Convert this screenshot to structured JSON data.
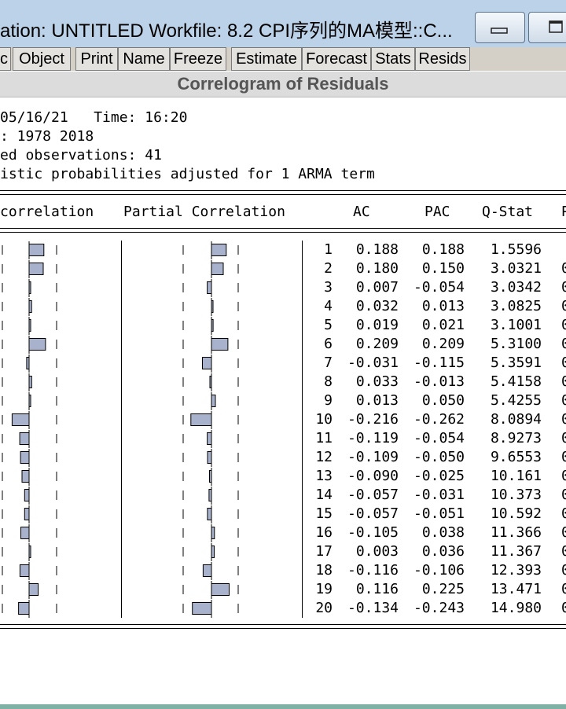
{
  "window": {
    "title": "ation: UNTITLED   Workfile: 8.2 CPI序列的MA模型::C..."
  },
  "toolbar": {
    "buttons": [
      "c",
      "Object",
      "Print",
      "Name",
      "Freeze",
      "Estimate",
      "Forecast",
      "Stats",
      "Resids"
    ]
  },
  "view": {
    "title": "Correlogram of Residuals"
  },
  "header": {
    "line1": "05/16/21   Time: 16:20",
    "line2": ": 1978 2018",
    "line3": "ed observations: 41",
    "line4": "istic probabilities adjusted for 1 ARMA term"
  },
  "columns": {
    "autocorrelation": "correlation",
    "partial": "Partial Correlation",
    "ac": "AC",
    "pac": "PAC",
    "qstat": "Q-Stat",
    "prob": "P"
  },
  "chart_data": {
    "type": "table",
    "lags": [
      1,
      2,
      3,
      4,
      5,
      6,
      7,
      8,
      9,
      10,
      11,
      12,
      13,
      14,
      15,
      16,
      17,
      18,
      19,
      20
    ],
    "ac": [
      0.188,
      0.18,
      0.007,
      0.032,
      0.019,
      0.209,
      -0.031,
      0.033,
      0.013,
      -0.216,
      -0.119,
      -0.109,
      -0.09,
      -0.057,
      -0.057,
      -0.105,
      0.003,
      -0.116,
      0.116,
      -0.134
    ],
    "pac": [
      0.188,
      0.15,
      -0.054,
      0.013,
      0.021,
      0.209,
      -0.115,
      -0.013,
      0.05,
      -0.262,
      -0.054,
      -0.05,
      -0.025,
      -0.031,
      -0.051,
      0.038,
      0.036,
      -0.106,
      0.225,
      -0.243
    ],
    "qstat": [
      "1.5596",
      "3.0321",
      "3.0342",
      "3.0825",
      "3.1001",
      "5.3100",
      "5.3591",
      "5.4158",
      "5.4255",
      "8.0894",
      "8.9273",
      "9.6553",
      "10.161",
      "10.373",
      "10.592",
      "11.366",
      "11.367",
      "12.393",
      "13.471",
      "14.980"
    ],
    "prob_partial": [
      "",
      "0",
      "0",
      "0",
      "0",
      "0",
      "0",
      "0",
      "0",
      "0",
      "0",
      "0",
      "0",
      "0",
      "0",
      "0",
      "0",
      "0",
      "0",
      "0"
    ],
    "bar_color": "#a9b2cc"
  }
}
